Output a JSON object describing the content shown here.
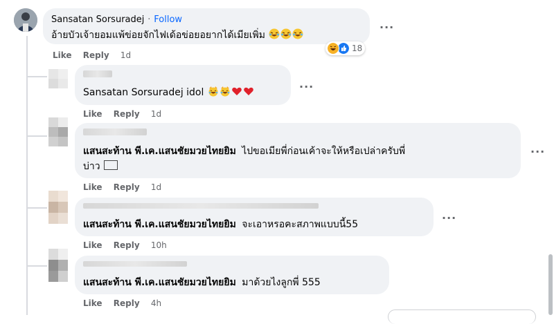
{
  "comments": [
    {
      "author": "Sansatan Sorsuradej",
      "follow_sep": "·",
      "follow_label": "Follow",
      "text": "อ้ายบัวเจ้ายอมแพ้ข่อยจักไฟเด้อข่อยอยากได้เมียเพิ่ม",
      "reaction_count": "18",
      "like_label": "Like",
      "reply_label": "Reply",
      "time": "1d"
    }
  ],
  "replies": [
    {
      "text": "Sansatan Sorsuradej idol",
      "like_label": "Like",
      "reply_label": "Reply",
      "time": "1d"
    },
    {
      "author": "แสนสะท้าน พี.เค.แสนชัยมวยไทยยิม",
      "text_line1": "ไปขอเมียพี่ก่อนเค้าจะให้หรือเปล่าครับพี่",
      "text_line2": "บ่าว",
      "like_label": "Like",
      "reply_label": "Reply",
      "time": "1d"
    },
    {
      "author": "แสนสะท้าน พี.เค.แสนชัยมวยไทยยิม",
      "text": "จะเอาหรอคะสภาพแบบนี้55",
      "like_label": "Like",
      "reply_label": "Reply",
      "time": "10h"
    },
    {
      "author": "แสนสะท้าน พี.เค.แสนชัยมวยไทยยิม",
      "text": "มาด้วยไงลูกพี่ 555",
      "like_label": "Like",
      "reply_label": "Reply",
      "time": "4h"
    }
  ],
  "more_label": "···",
  "colors": {
    "bubble": "#f0f2f5",
    "link": "#0866ff",
    "muted": "#65676b"
  },
  "icons": [
    "avatar",
    "laughing-emoji",
    "like-reaction-icon",
    "haha-reaction-icon",
    "heart-emoji",
    "cat-laughing-emoji",
    "more-options-icon"
  ]
}
